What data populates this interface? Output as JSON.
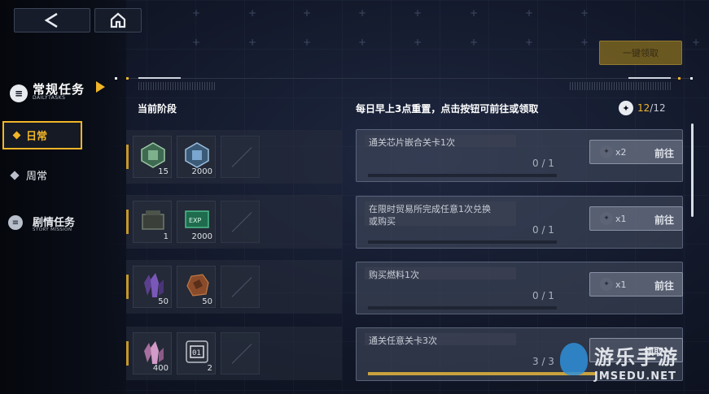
{
  "colors": {
    "accent": "#f1b528",
    "panel": "#465060",
    "background": "#121829"
  },
  "nav": {
    "back_icon": "back-arrow-icon",
    "home_icon": "home-icon"
  },
  "sidebar": {
    "category_title": "常规任务",
    "category_subtitle": "DAILYTASKS",
    "items": [
      {
        "label": "日常",
        "active": true
      },
      {
        "label": "周常",
        "active": false
      }
    ],
    "story": {
      "label": "剧情任务",
      "subtitle": "STORY MISSION"
    }
  },
  "header": {
    "claim_all": "一键领取",
    "stage_title": "当前阶段",
    "reset_info": "每日早上3点重置，点击按钮可前往或领取",
    "count_current": "12",
    "count_total": "/12"
  },
  "reward_rows": [
    {
      "items": [
        {
          "icon": "green-chip-icon",
          "qty": "15"
        },
        {
          "icon": "blue-chip-icon",
          "qty": "2000"
        }
      ]
    },
    {
      "items": [
        {
          "icon": "fuel-box-icon",
          "qty": "1"
        },
        {
          "icon": "exp-card-icon",
          "qty": "2000"
        }
      ]
    },
    {
      "items": [
        {
          "icon": "purple-crystal-icon",
          "qty": "50"
        },
        {
          "icon": "ore-icon",
          "qty": "50"
        }
      ]
    },
    {
      "items": [
        {
          "icon": "pink-crystal-icon",
          "qty": "400"
        },
        {
          "icon": "ticket-01-icon",
          "qty": "2"
        }
      ]
    }
  ],
  "tasks": [
    {
      "name": "通关芯片嵌合关卡1次",
      "progress": "0 / 1",
      "fraction": 0,
      "multiplier": "x2",
      "button": "前往"
    },
    {
      "name": "在限时贸易所完成任意1次兑换\n或购买",
      "progress": "0 / 1",
      "fraction": 0,
      "multiplier": "x1",
      "button": "前往"
    },
    {
      "name": "购买燃料1次",
      "progress": "0 / 1",
      "fraction": 0,
      "multiplier": "x1",
      "button": "前往"
    },
    {
      "name": "通关任意关卡3次",
      "progress": "3 / 3",
      "fraction": 1,
      "multiplier": "",
      "button": "领取"
    }
  ],
  "watermark": {
    "cn": "游乐手游",
    "en": "JMSEDU.NET"
  }
}
